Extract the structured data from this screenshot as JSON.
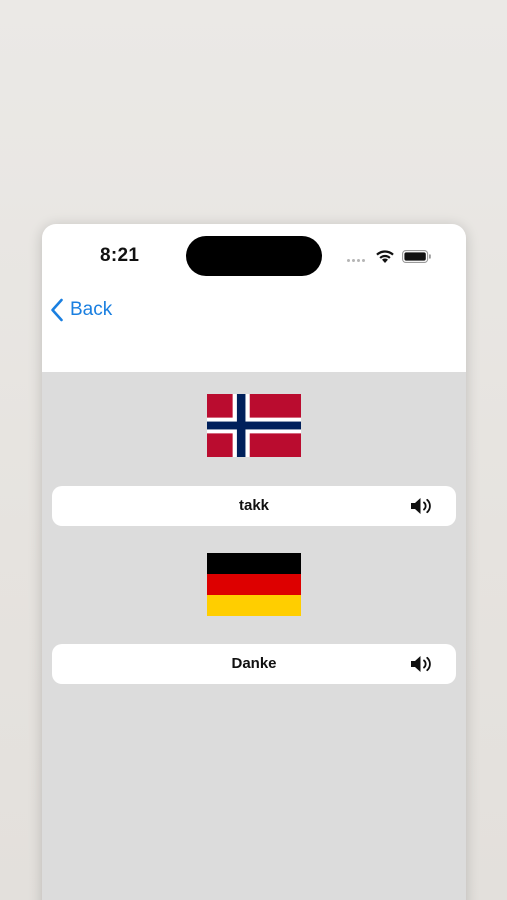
{
  "status_bar": {
    "time": "8:21"
  },
  "nav": {
    "back_label": "Back"
  },
  "colors": {
    "accent": "#1a7fe0",
    "content_bg": "#dcdcdc",
    "card_bg": "#ffffff"
  },
  "translations": [
    {
      "flag_icon": "norway-flag-icon",
      "word": "takk",
      "speaker_icon": "speaker-icon"
    },
    {
      "flag_icon": "germany-flag-icon",
      "word": "Danke",
      "speaker_icon": "speaker-icon"
    }
  ]
}
